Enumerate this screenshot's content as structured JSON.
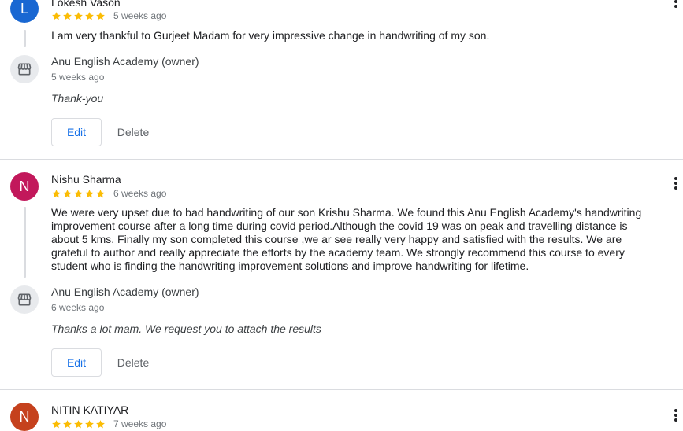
{
  "colors": {
    "star": "#fbbc04",
    "link_blue": "#1a73e8",
    "avatar_l": "#1967d2",
    "avatar_n1": "#c2185b",
    "avatar_n2": "#c5411d"
  },
  "icons": {
    "star": "star-icon",
    "store": "store-icon",
    "more": "more-vert-icon"
  },
  "reviews": [
    {
      "avatar_letter": "L",
      "name": "Lokesh Vason",
      "rating": 5,
      "age": "5 weeks ago",
      "text": "I am very thankful to Gurjeet Madam for very impressive change in handwriting of my son.",
      "reply": {
        "owner": "Anu English Academy (owner)",
        "age": "5 weeks ago",
        "text": "Thank-you",
        "edit_label": "Edit",
        "delete_label": "Delete"
      }
    },
    {
      "avatar_letter": "N",
      "name": "Nishu Sharma",
      "rating": 5,
      "age": "6 weeks ago",
      "text": "We were very upset due to bad handwriting of our son Krishu Sharma. We found this Anu English Academy's handwriting improvement course after a long time during covid period.Although the covid 19 was on peak and travelling distance is about 5 kms. Finally my son completed this course ,we ar see really very happy and satisfied with the results. We are grateful to author and really appreciate the efforts by the academy team. We strongly recommend this course to every student who is finding the handwriting improvement solutions and improve handwriting for lifetime.",
      "reply": {
        "owner": "Anu English Academy (owner)",
        "age": "6 weeks ago",
        "text": "Thanks a lot mam. We request you to attach the results",
        "edit_label": "Edit",
        "delete_label": "Delete"
      }
    },
    {
      "avatar_letter": "N",
      "name": "NITIN KATIYAR",
      "rating": 5,
      "age": "7 weeks ago"
    }
  ]
}
